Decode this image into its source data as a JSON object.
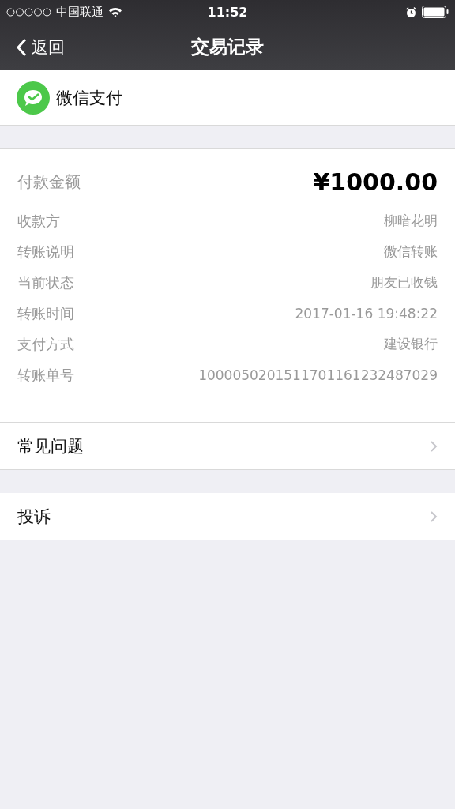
{
  "status_bar": {
    "carrier": "中国联通",
    "time": "11:52"
  },
  "nav": {
    "back": "返回",
    "title": "交易记录"
  },
  "merchant": {
    "name": "微信支付"
  },
  "amount": {
    "label": "付款金额",
    "value": "¥1000.00"
  },
  "details": [
    {
      "label": "收款方",
      "value": "柳暗花明"
    },
    {
      "label": "转账说明",
      "value": "微信转账"
    },
    {
      "label": "当前状态",
      "value": "朋友已收钱"
    },
    {
      "label": "转账时间",
      "value": "2017-01-16 19:48:22"
    },
    {
      "label": "支付方式",
      "value": "建设银行"
    },
    {
      "label": "转账单号",
      "value": "1000050201511701161232487029"
    }
  ],
  "links": [
    {
      "label": "常见问题"
    },
    {
      "label": "投诉"
    }
  ]
}
